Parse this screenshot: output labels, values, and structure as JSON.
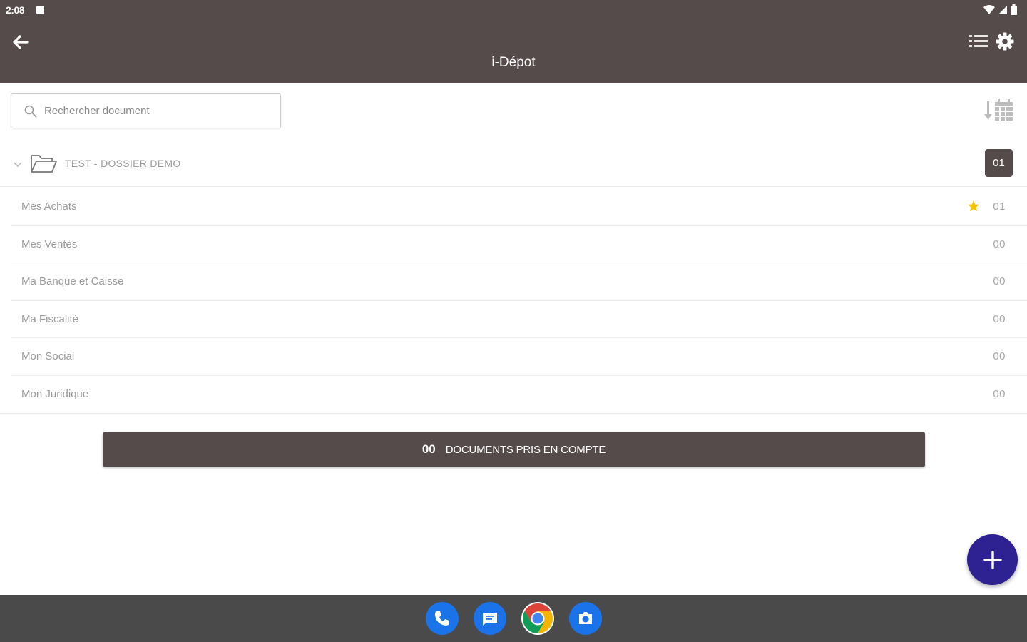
{
  "status_bar": {
    "time": "2:08"
  },
  "header": {
    "title": "i-Dépot"
  },
  "search": {
    "placeholder": "Rechercher document"
  },
  "folder": {
    "label": "TEST - DOSSIER DEMO",
    "count": "01"
  },
  "categories": [
    {
      "label": "Mes Achats",
      "count": "01",
      "starred": true
    },
    {
      "label": "Mes Ventes",
      "count": "00",
      "starred": false
    },
    {
      "label": "Ma Banque et Caisse",
      "count": "00",
      "starred": false
    },
    {
      "label": "Ma Fiscalité",
      "count": "00",
      "starred": false
    },
    {
      "label": "Mon Social",
      "count": "00",
      "starred": false
    },
    {
      "label": "Mon Juridique",
      "count": "00",
      "starred": false
    }
  ],
  "summary": {
    "count": "00",
    "label": "DOCUMENTS PRIS EN COMPTE"
  },
  "colors": {
    "brand_brown": "#554b4a",
    "fab_indigo": "#2e2192",
    "star_yellow": "#f5c400"
  },
  "icons": {
    "back": "arrow-left-icon",
    "list": "list-icon",
    "settings": "gear-icon",
    "search": "search-icon",
    "sort": "sort-calendar-icon",
    "chevron": "chevron-down-icon",
    "folder": "folder-open-icon",
    "star": "star-icon",
    "add": "plus-icon"
  },
  "dock": [
    "phone",
    "messages",
    "chrome",
    "camera"
  ]
}
